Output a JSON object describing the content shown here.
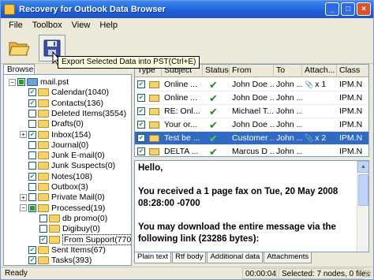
{
  "window": {
    "title": "Recovery for Outlook Data Browser",
    "controls": [
      "_",
      "□",
      "×"
    ]
  },
  "menu": [
    "File",
    "Toolbox",
    "View",
    "Help"
  ],
  "toolbar": {
    "open_icon": "folder-open-icon",
    "save_icon": "save-disk-icon",
    "tooltip": "Export Selected Data into PST(Ctrl+E)"
  },
  "browse_tab": "Browse",
  "tree": [
    {
      "label": "mail.pst",
      "level": 0,
      "cb": "partial",
      "exp": "−",
      "icon": "pst"
    },
    {
      "label": "Calendar(1040)",
      "level": 1,
      "cb": "checked",
      "exp": ""
    },
    {
      "label": "Contacts(136)",
      "level": 1,
      "cb": "checked",
      "exp": ""
    },
    {
      "label": "Deleted Items(3554)",
      "level": 1,
      "cb": "",
      "exp": ""
    },
    {
      "label": "Drafts(0)",
      "level": 1,
      "cb": "",
      "exp": ""
    },
    {
      "label": "Inbox(154)",
      "level": 1,
      "cb": "checked",
      "exp": "+"
    },
    {
      "label": "Journal(0)",
      "level": 1,
      "cb": "",
      "exp": ""
    },
    {
      "label": "Junk E-mail(0)",
      "level": 1,
      "cb": "",
      "exp": ""
    },
    {
      "label": "Junk Suspects(0)",
      "level": 1,
      "cb": "",
      "exp": ""
    },
    {
      "label": "Notes(108)",
      "level": 1,
      "cb": "checked",
      "exp": ""
    },
    {
      "label": "Outbox(3)",
      "level": 1,
      "cb": "",
      "exp": ""
    },
    {
      "label": "Private Mail(0)",
      "level": 1,
      "cb": "",
      "exp": "+"
    },
    {
      "label": "Processed(19)",
      "level": 1,
      "cb": "partial",
      "exp": "−"
    },
    {
      "label": "db promo(0)",
      "level": 2,
      "cb": "",
      "exp": ""
    },
    {
      "label": "Digibuy(0)",
      "level": 2,
      "cb": "",
      "exp": ""
    },
    {
      "label": "From Support(770)",
      "level": 2,
      "cb": "checked",
      "exp": "",
      "sel": true
    },
    {
      "label": "Sent Items(67)",
      "level": 1,
      "cb": "checked",
      "exp": ""
    },
    {
      "label": "Tasks(393)",
      "level": 1,
      "cb": "checked",
      "exp": ""
    }
  ],
  "grid": {
    "columns": [
      "Type",
      "Subject",
      "Status",
      "From",
      "To",
      "Attach...",
      "Class"
    ],
    "rows": [
      {
        "subject": "Online ...",
        "status": "✔",
        "from": "John Doe ...",
        "to": "John ...",
        "attach": "x 1",
        "clip": true,
        "class": "IPM.N",
        "sel": false
      },
      {
        "subject": "Online ...",
        "status": "✔",
        "from": "John Doe ...",
        "to": "John ...",
        "attach": "",
        "clip": false,
        "class": "IPM.N",
        "sel": false
      },
      {
        "subject": "RE: Onl...",
        "status": "✔",
        "from": "Michael T...",
        "to": "John ...",
        "attach": "",
        "clip": false,
        "class": "IPM.N",
        "sel": false
      },
      {
        "subject": "Your or...",
        "status": "✔",
        "from": "John Doe ...",
        "to": "John ...",
        "attach": "",
        "clip": false,
        "class": "IPM.N",
        "sel": false
      },
      {
        "subject": "Test be ...",
        "status": "✔",
        "from": "Customer ...",
        "to": "John ...",
        "attach": "x 2",
        "clip": true,
        "class": "IPM.N",
        "sel": true
      },
      {
        "subject": "DELTA ...",
        "status": "✔",
        "from": "Marcus D ...",
        "to": "John ...",
        "attach": "",
        "clip": false,
        "class": "IPM.N",
        "sel": false
      }
    ]
  },
  "preview": {
    "body": "Hello,\n\nYou received a 1 page fax on Tue, 20 May 2008 08:28:00 -0700\n\nYou may download the entire message via the following link (23286 bytes):",
    "tabs": [
      "Plain text",
      "Rtf body",
      "Additional data",
      "Attachments"
    ]
  },
  "status": {
    "left": "Ready",
    "time": "00:00:04",
    "selection": "Selected: 7 nodes, 0 files"
  }
}
